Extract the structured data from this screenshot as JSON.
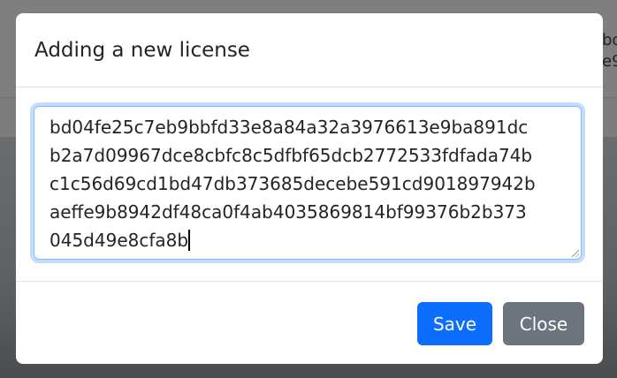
{
  "background": {
    "text_lines": [
      "bo",
      "e9"
    ]
  },
  "modal": {
    "title": "Adding a new license",
    "license_lines": [
      "bd04fe25c7eb9bbfd33e8a84a32a3976613e9ba891dc",
      "b2a7d09967dce8cbfc8c5dfbf65dcb2772533fdfada74b",
      "c1c56d69cd1bd47db373685decebe591cd901897942b",
      "aeffe9b8942df48ca0f4ab4035869814bf99376b2b373",
      "045d49e8cfa8b"
    ],
    "save_label": "Save",
    "close_label": "Close"
  }
}
